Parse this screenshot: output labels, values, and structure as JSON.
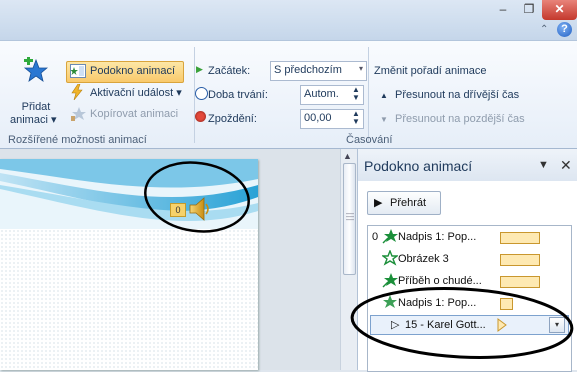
{
  "window": {
    "minimize_glyph": "–",
    "restore_glyph": "❐",
    "close_glyph": "✕",
    "collapse_glyph": "⌃",
    "help_glyph": "?"
  },
  "ribbon": {
    "add_animation": {
      "line1": "Přidat",
      "line2": "animaci ▾"
    },
    "animation_pane_button": "Podokno animací",
    "trigger": "Aktivační událost ▾",
    "copy_animation": "Kopírovat animaci",
    "group_advanced": "Rozšířené možnosti animací",
    "start_label": "Začátek:",
    "start_value": "S předchozím",
    "duration_label": "Doba trvání:",
    "duration_value": "Autom.",
    "delay_label": "Zpoždění:",
    "delay_value": "00,00",
    "reorder_title": "Změnit pořadí animace",
    "move_earlier": "Přesunout na dřívější čas",
    "move_later": "Přesunout na pozdější čas",
    "group_timing": "Časování"
  },
  "slide": {
    "tag": "0"
  },
  "pane": {
    "title": "Podokno animací",
    "menu_glyph": "▼",
    "close_glyph": "✕",
    "play_label": "Přehrát",
    "items": [
      {
        "num": "0",
        "label": "Nadpis 1: Pop...",
        "bar": 1.0
      },
      {
        "num": "",
        "label": "Obrázek 3",
        "bar": 1.0
      },
      {
        "num": "",
        "label": "Příběh o chudé...",
        "bar": 1.0
      },
      {
        "num": "",
        "label": "Nadpis 1: Pop...",
        "bar": 0.3
      },
      {
        "num": "",
        "label": "15 - Karel Gott...",
        "bar": 0.0
      }
    ]
  },
  "colors": {
    "accent": "#f9c96b",
    "anim_star": "#1b8f3a",
    "selection": "#e9f1fb"
  }
}
